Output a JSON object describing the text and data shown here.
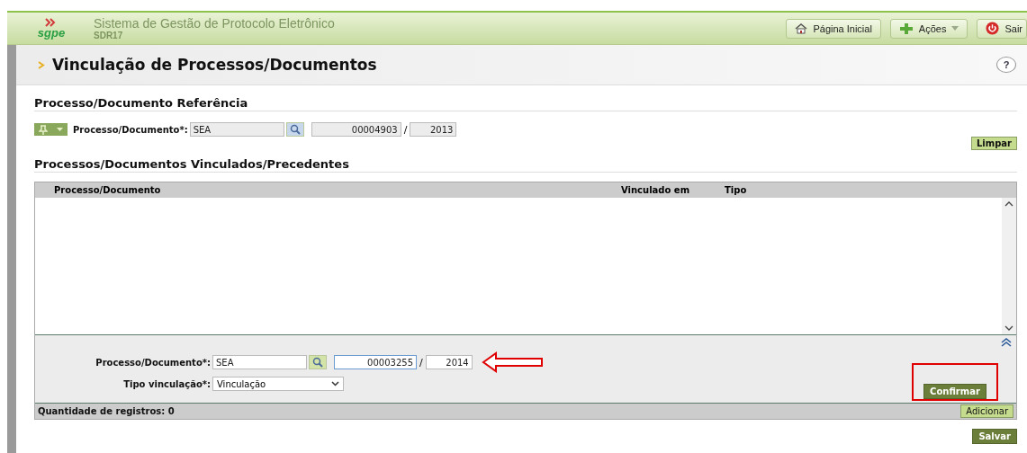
{
  "header": {
    "logo": "sgpe",
    "title": "Sistema de Gestão de Protocolo Eletrônico",
    "subtitle": "SDR17",
    "buttons": [
      {
        "label": "Página Inicial",
        "kind": "home"
      },
      {
        "label": "Ações",
        "kind": "menu"
      },
      {
        "label": "Sair",
        "kind": "exit"
      }
    ]
  },
  "page": {
    "title": "Vinculação de Processos/Documentos",
    "help": "?"
  },
  "reference": {
    "heading": "Processo/Documento Referência",
    "label": "Processo/Documento*:",
    "type": "SEA",
    "number": "00004903",
    "separator": "/",
    "year": "2013",
    "button": "Limpar"
  },
  "linked": {
    "heading": "Processos/Documentos Vinculados/Precedentes",
    "columns": [
      "Processo/Documento",
      "Vinculado em",
      "Tipo"
    ],
    "form": {
      "label": "Processo/Documento*:",
      "type": "SEA",
      "number": "00003255",
      "number_focused": true,
      "separator": "/",
      "year": "2014",
      "link_type_label": "Tipo vinculação*:",
      "link_type": "Vinculação",
      "confirm": "Confirmar"
    },
    "count": "Quantidade de registros: 0",
    "add": "Adicionar"
  },
  "save": "Salvar"
}
